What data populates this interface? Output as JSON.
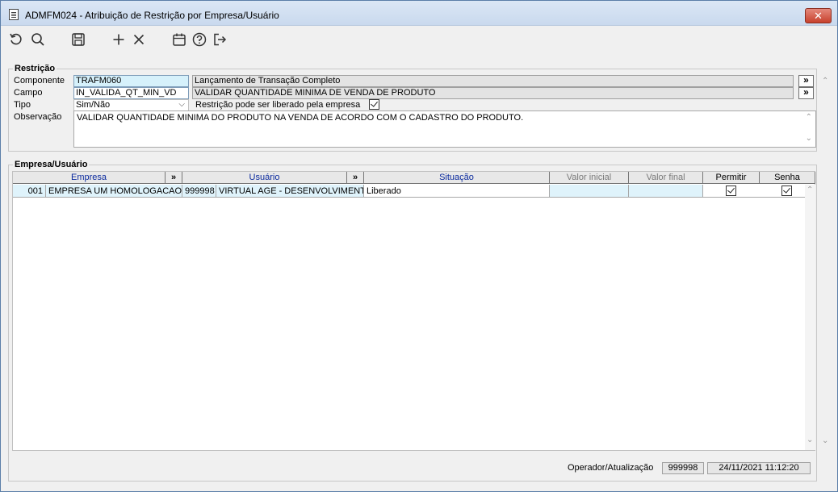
{
  "window": {
    "title": "ADMFM024 - Atribuição de Restrição por Empresa/Usuário",
    "close_label": "✕"
  },
  "toolbar": {
    "icons": [
      "refresh-icon",
      "search-icon",
      "save-icon",
      "add-icon",
      "delete-icon",
      "calendar-icon",
      "help-icon",
      "exit-icon"
    ]
  },
  "restricao": {
    "group_label": "Restrição",
    "componente_label": "Componente",
    "componente_value": "TRAFM060",
    "componente_desc": "Lançamento de Transação Completo",
    "campo_label": "Campo",
    "campo_value": "IN_VALIDA_QT_MIN_VD",
    "campo_desc": "VALIDAR QUANTIDADE MINIMA DE VENDA DE PRODUTO",
    "tipo_label": "Tipo",
    "tipo_value": "Sim/Não",
    "liberado_label": "Restrição pode ser liberado pela empresa",
    "liberado_checked": true,
    "observacao_label": "Observação",
    "observacao_value": "VALIDAR QUANTIDADE MINIMA DO PRODUTO NA VENDA DE ACORDO COM O CADASTRO DO PRODUTO.",
    "lookup_label": "»"
  },
  "empresa_usuario": {
    "group_label": "Empresa/Usuário",
    "columns": {
      "empresa": "Empresa",
      "usuario": "Usuário",
      "situacao": "Situação",
      "valor_inicial": "Valor inicial",
      "valor_final": "Valor final",
      "permitir": "Permitir",
      "senha": "Senha",
      "lookup": "»"
    },
    "rows": [
      {
        "empresa_code": "001",
        "empresa_name": "EMPRESA UM HOMOLOGACAO",
        "usuario_code": "999998",
        "usuario_name": "VIRTUAL AGE - DESENVOLVIMENTO",
        "situacao": "Liberado",
        "valor_inicial": "",
        "valor_final": "",
        "permitir": true,
        "senha": true
      }
    ]
  },
  "footer": {
    "label": "Operador/Atualização",
    "operador": "999998",
    "data": "24/11/2021 11:12:20"
  }
}
